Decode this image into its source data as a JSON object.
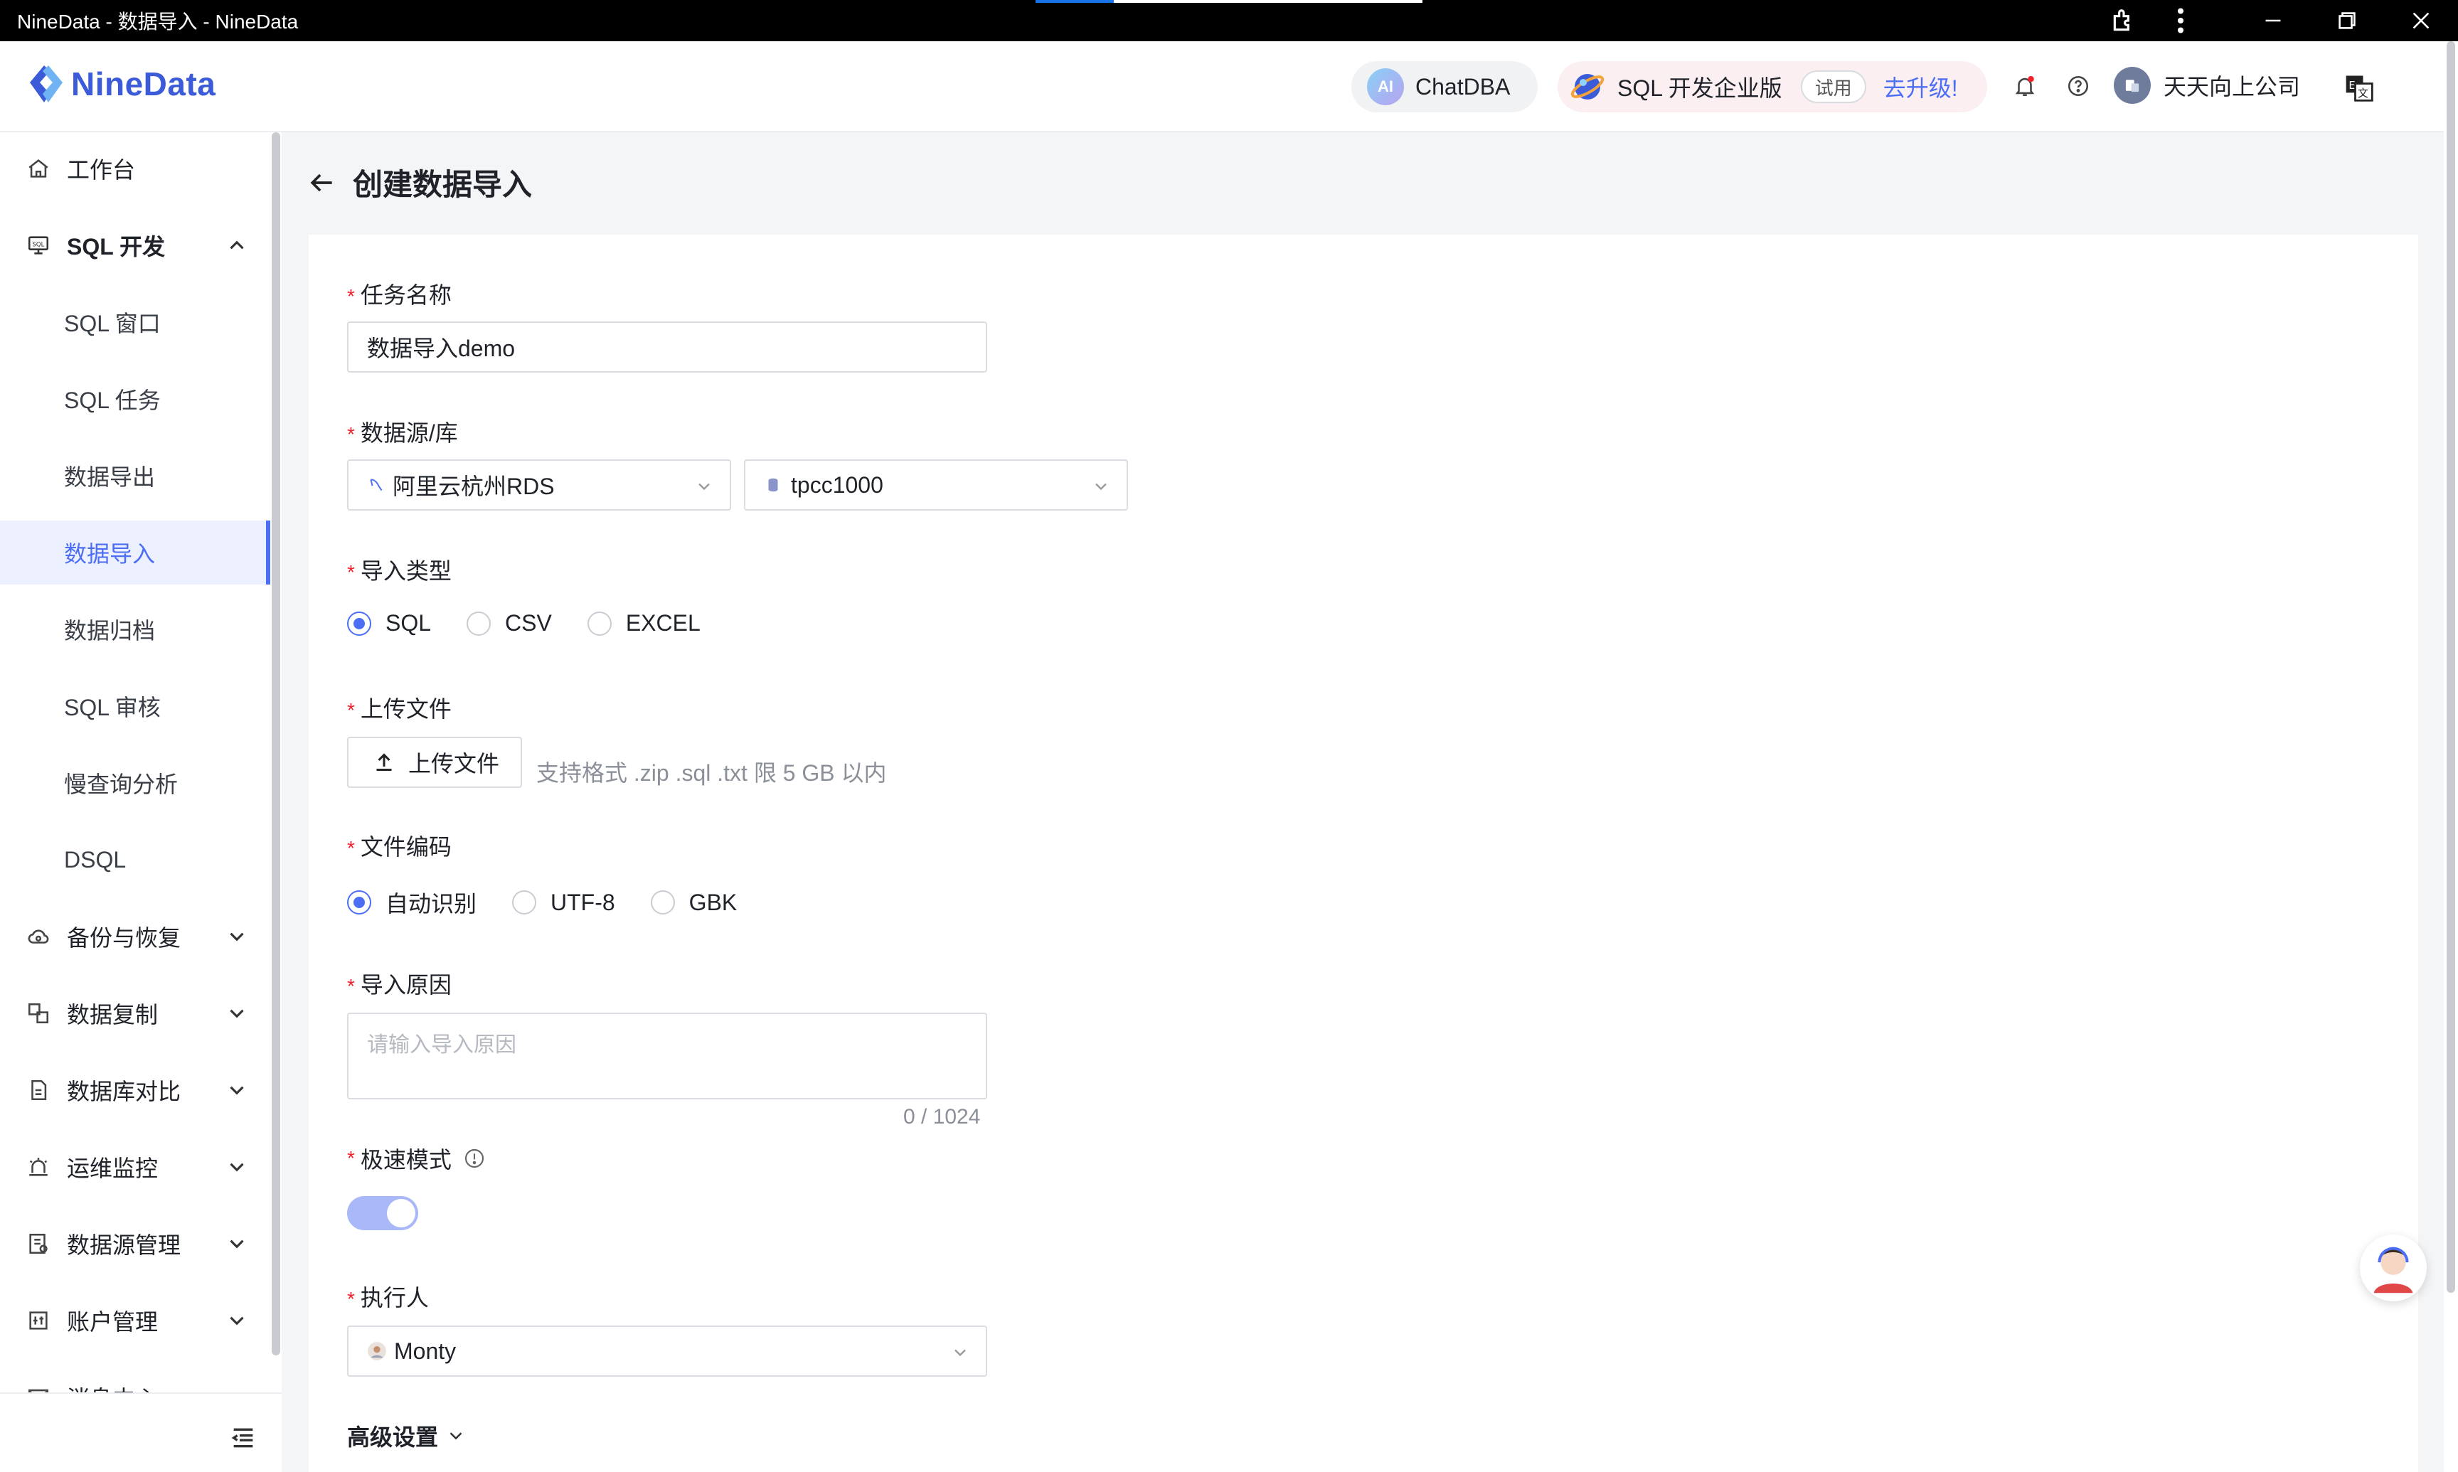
{
  "window": {
    "title": "NineData - 数据导入 - NineData"
  },
  "header": {
    "logo_text": "NineData",
    "chatdba_badge": "AI",
    "chatdba_label": "ChatDBA",
    "edition_label": "SQL 开发企业版",
    "trial_badge": "试用",
    "upgrade_link": "去升级!",
    "company_name": "天天向上公司",
    "accent_color": "#4c6ef5"
  },
  "sidebar": {
    "items": [
      {
        "label": "工作台",
        "icon": "home-icon"
      },
      {
        "label": "SQL 开发",
        "icon": "sql-monitor-icon"
      },
      {
        "label": "SQL 窗口"
      },
      {
        "label": "SQL 任务"
      },
      {
        "label": "数据导出"
      },
      {
        "label": "数据导入"
      },
      {
        "label": "数据归档"
      },
      {
        "label": "SQL 审核"
      },
      {
        "label": "慢查询分析"
      },
      {
        "label": "DSQL"
      },
      {
        "label": "备份与恢复",
        "icon": "cloud-backup-icon"
      },
      {
        "label": "数据复制",
        "icon": "copy-icon"
      },
      {
        "label": "数据库对比",
        "icon": "compare-icon"
      },
      {
        "label": "运维监控",
        "icon": "alarm-icon"
      },
      {
        "label": "数据源管理",
        "icon": "datasource-icon"
      },
      {
        "label": "账户管理",
        "icon": "account-icon"
      },
      {
        "label": "消息中心",
        "icon": "mail-icon"
      }
    ]
  },
  "page": {
    "title": "创建数据导入"
  },
  "form": {
    "task_name": {
      "label": "任务名称",
      "value": "数据导入demo"
    },
    "datasource": {
      "label": "数据源/库",
      "source": "阿里云杭州RDS",
      "database": "tpcc1000"
    },
    "import_type": {
      "label": "导入类型",
      "options": [
        "SQL",
        "CSV",
        "EXCEL"
      ],
      "selected": "SQL"
    },
    "upload": {
      "label": "上传文件",
      "button": "上传文件",
      "hint": "支持格式 .zip .sql .txt 限 5 GB 以内"
    },
    "encoding": {
      "label": "文件编码",
      "options": [
        "自动识别",
        "UTF-8",
        "GBK"
      ],
      "selected": "自动识别"
    },
    "reason": {
      "label": "导入原因",
      "placeholder": "请输入导入原因",
      "counter": "0 / 1024"
    },
    "fast_mode": {
      "label": "极速模式",
      "enabled": true
    },
    "executor": {
      "label": "执行人",
      "value": "Monty"
    },
    "advanced": {
      "label": "高级设置"
    }
  }
}
